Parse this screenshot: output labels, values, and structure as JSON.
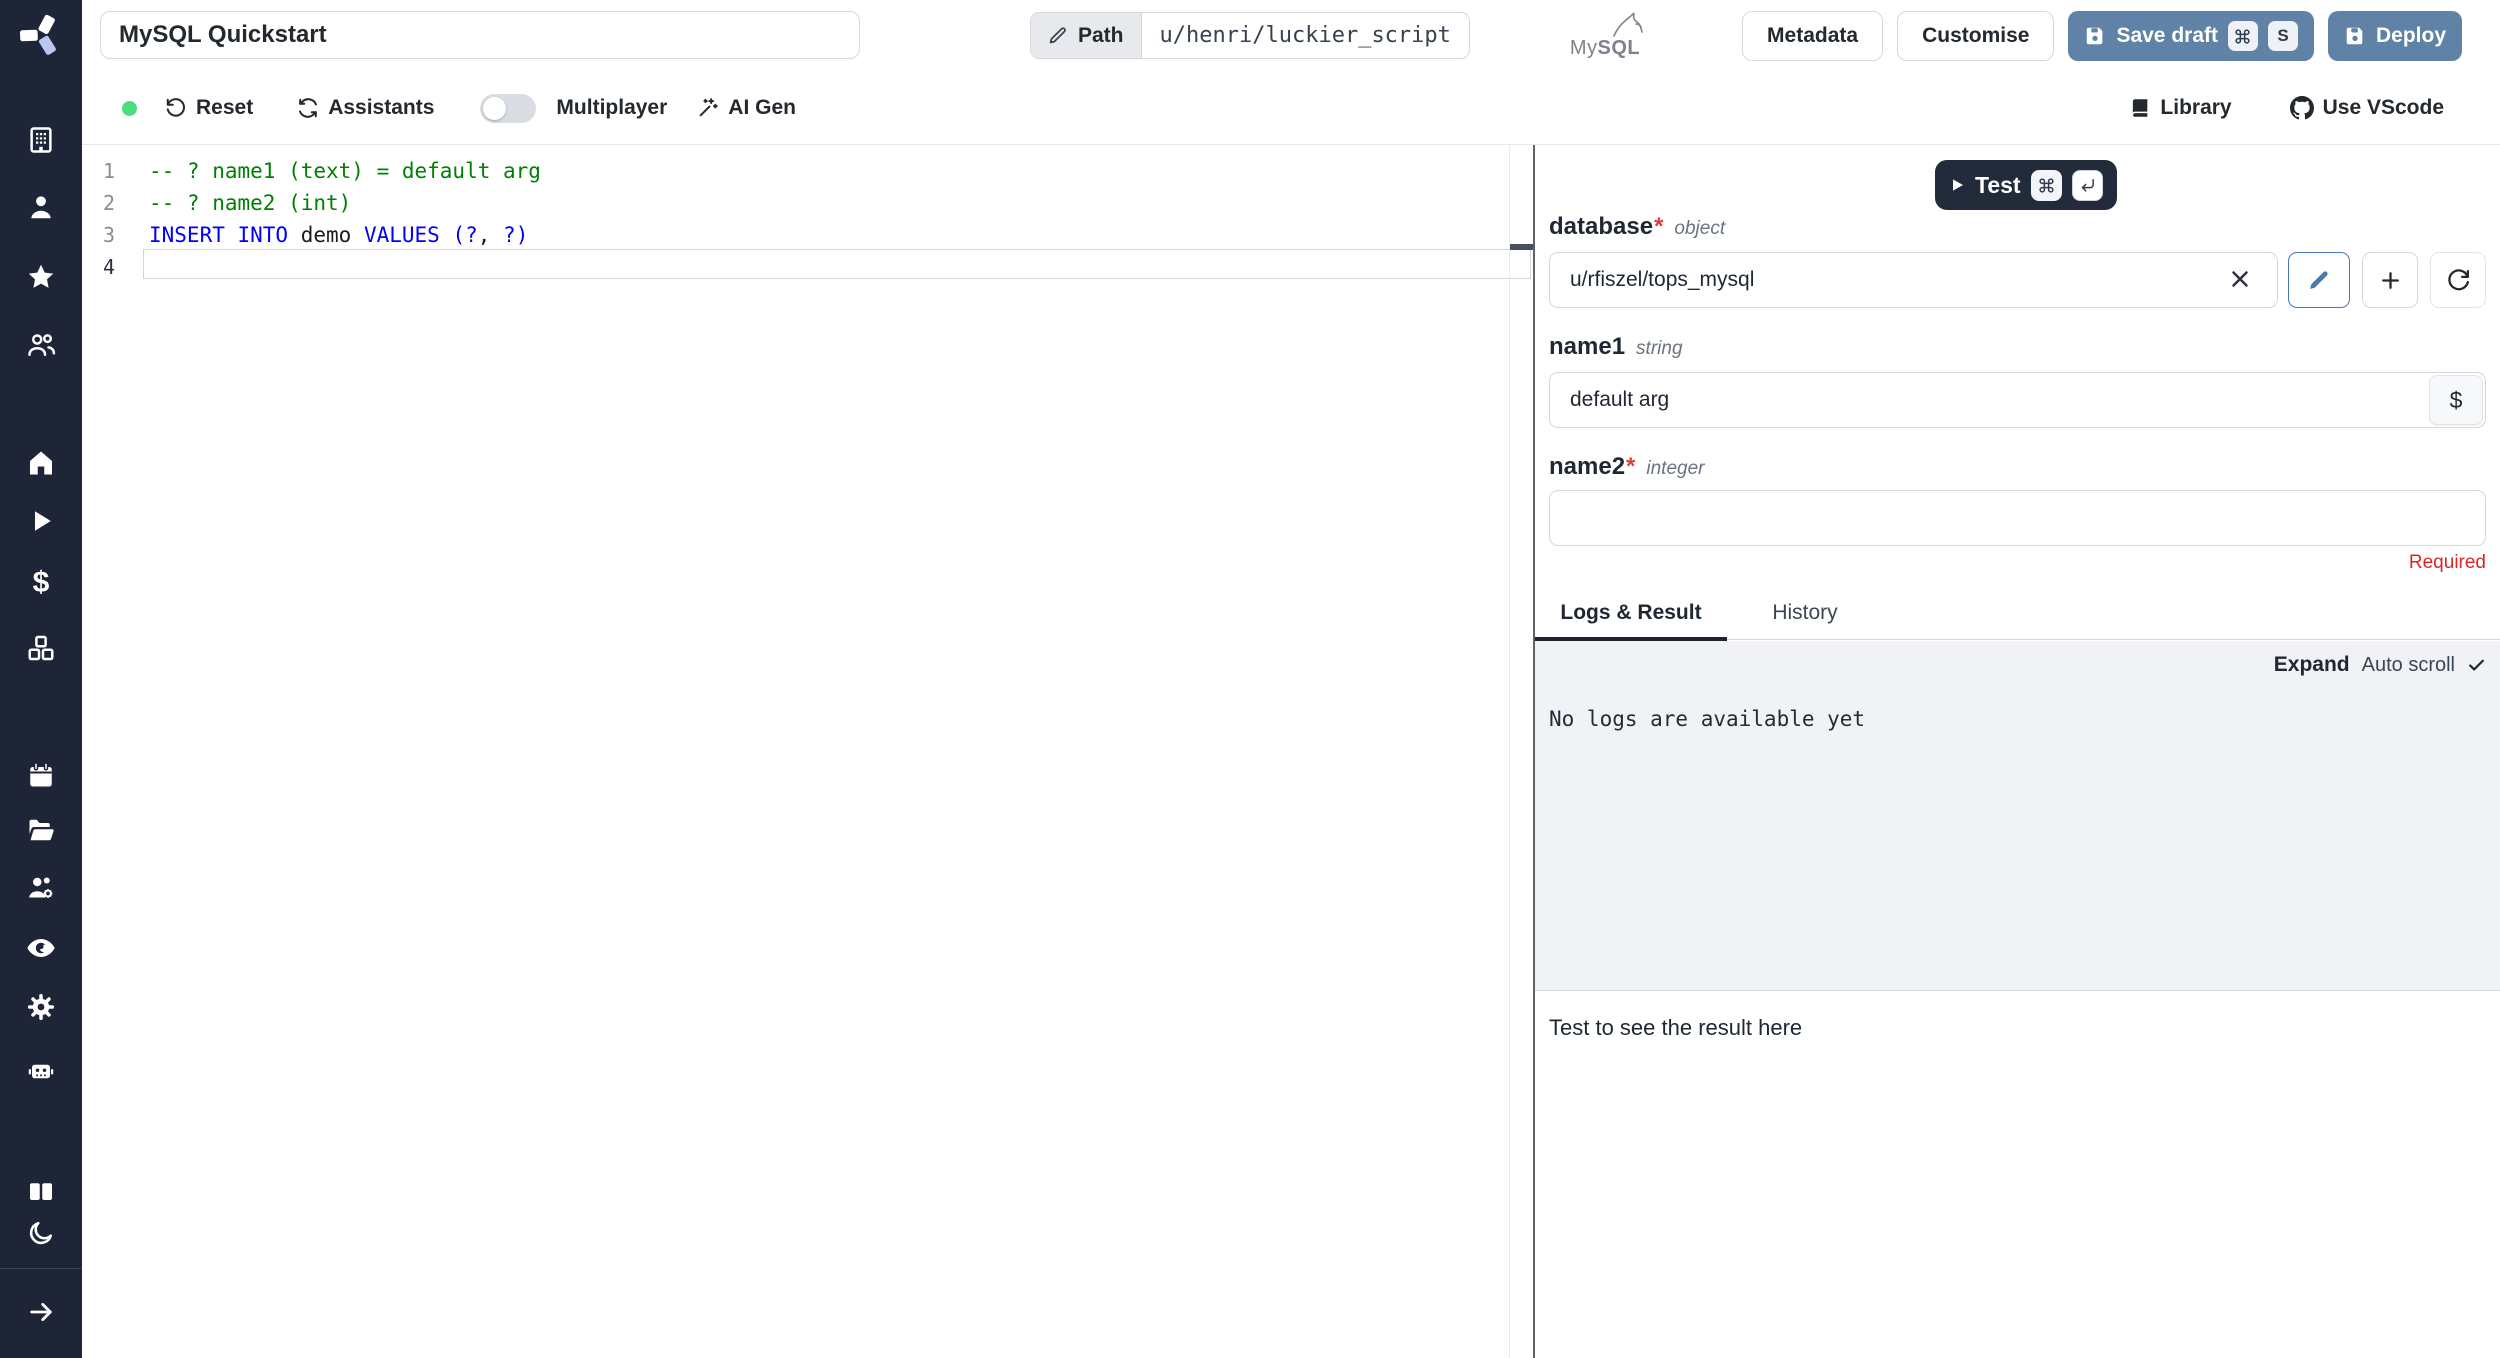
{
  "colors": {
    "sidebar_bg": "#1e2536",
    "accent_button": "#6082a6",
    "dark_button": "#222b3a",
    "status_green": "#4ade80",
    "required_red": "#dc2626",
    "keyword_blue": "#0000ff",
    "comment_green": "#008000",
    "logs_bg": "#f0f2f5"
  },
  "sidebar": {
    "icons": [
      "windmill-logo",
      "building",
      "user",
      "star",
      "users",
      "home",
      "play",
      "dollar",
      "boxes",
      "calendar",
      "folder-open",
      "users-cog",
      "eye",
      "settings-gear",
      "robot",
      "book-open",
      "moon",
      "expand-arrow"
    ]
  },
  "glyphs": {
    "dollar": "$"
  },
  "topbar": {
    "title_value": "MySQL Quickstart",
    "path_label": "Path",
    "path_value": "u/henri/luckier_script",
    "language_word_prefix": "My",
    "language_word_suffix": "SQL",
    "metadata_label": "Metadata",
    "customise_label": "Customise",
    "save_draft_label": "Save draft",
    "save_draft_shortcut_key": "S",
    "deploy_label": "Deploy"
  },
  "toolbar": {
    "reset_label": "Reset",
    "assistants_label": "Assistants",
    "multiplayer_label": "Multiplayer",
    "multiplayer_on": false,
    "ai_gen_label": "AI Gen",
    "library_label": "Library",
    "vscode_label": "Use VScode"
  },
  "editor": {
    "gutter": [
      "1",
      "2",
      "3",
      "4"
    ],
    "line1_comment": "-- ? name1 (text) = default arg",
    "line2_comment": "-- ? name2 (int)",
    "line3": {
      "kw1": "INSERT INTO",
      "plain1": " demo ",
      "kw2": "VALUES",
      "plain2": " ",
      "kw3": "(?",
      "plain3": ", ",
      "kw4": "?)"
    }
  },
  "panel": {
    "test_label": "Test",
    "fields": {
      "database": {
        "name": "database",
        "required_mark": "*",
        "type": "object",
        "value": "u/rfiszel/tops_mysql"
      },
      "name1": {
        "name": "name1",
        "type": "string",
        "value": "default arg"
      },
      "name2": {
        "name": "name2",
        "required_mark": "*",
        "type": "integer",
        "value": "",
        "error": "Required"
      }
    },
    "tabs": {
      "logs_result": "Logs & Result",
      "history": "History"
    },
    "logs": {
      "expand_label": "Expand",
      "autoscroll_label": "Auto scroll",
      "empty_message": "No logs are available yet"
    },
    "result_placeholder": "Test to see the result here"
  }
}
